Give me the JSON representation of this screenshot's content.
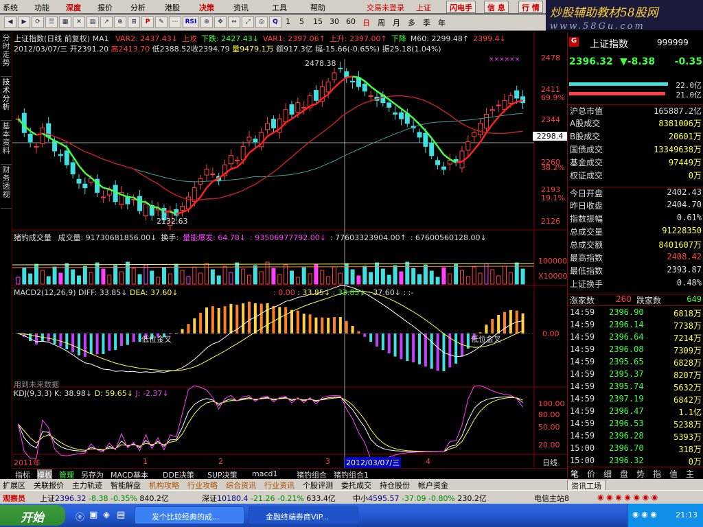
{
  "menu": {
    "items": [
      "系统",
      "功能",
      "深度",
      "报价",
      "分析",
      "港股",
      "决策",
      "资讯",
      "工具",
      "帮助"
    ],
    "login_status": "交易未登录",
    "shortcut": "上证",
    "buttons": [
      "闪电手",
      "信 息",
      "行 情"
    ]
  },
  "brand": {
    "name": "炒股辅助教材58股网",
    "url": "www.58Gu.com"
  },
  "toolbar": {
    "icons": [
      "P",
      "RSI",
      "Q"
    ],
    "periods": [
      "1",
      "5",
      "15",
      "30",
      "60",
      "日",
      "周",
      "月",
      "多",
      "季",
      "年"
    ]
  },
  "left_tabs": [
    "分时走势",
    "技术分析",
    "基本资料",
    "财务透视"
  ],
  "main": {
    "title": "上证指数(日线 前复权) MA1",
    "indicators": [
      {
        "text": "VAR2: 2437.43↓",
        "color": "#ff4040"
      },
      {
        "text": "上攻",
        "color": "#ff4040"
      },
      {
        "text": "下跌: 2427.43↓",
        "color": "#40ff40"
      },
      {
        "text": "VAR1: 2397.06↑",
        "color": "#ff4040"
      },
      {
        "text": "上升: 2397.00↑",
        "color": "#ff4040"
      },
      {
        "text": "下降",
        "color": "#40ff40"
      },
      {
        "text": "M60: 2299.48↑",
        "color": "#dddddd"
      },
      {
        "text": "2399.4↓",
        "color": "#ff4040"
      }
    ],
    "ohlc": {
      "date": "2012/03/07/三",
      "open": "开2391.20",
      "high": "高2413.70",
      "low": "低2388.52",
      "close": "收2394.79",
      "vol": "量9479.1万",
      "amount": "额917.3亿",
      "change": "幅-15.66(-0.65%)",
      "amplitude": "振25.18(1.04%)"
    },
    "price_axis": [
      "2478",
      "2411",
      "69.9%",
      "2344",
      "2298.4",
      "2260",
      "38.2%",
      "2193",
      "19.1%",
      "2126"
    ],
    "annotations": {
      "high": "2478.38",
      "low": "2132.63"
    },
    "current_price_tag": "2298.4"
  },
  "volume": {
    "title": "猪钓成交量",
    "items": [
      {
        "text": "成交量: 91730681856.00↓",
        "color": "#dddddd"
      },
      {
        "text": "换手:",
        "color": "#dddddd"
      },
      {
        "text": "量能爆发: 64.78↓",
        "color": "#ff40ff"
      },
      {
        "text": ": 93506977792.00↓",
        "color": "#ff40ff"
      },
      {
        "text": ": 77603323904.00↑",
        "color": "#dddddd"
      },
      {
        "text": ": 67600560128.00↓",
        "color": "#dddddd"
      }
    ],
    "axis": [
      "100000",
      "X10000"
    ]
  },
  "macd": {
    "title": "MACD2(12,26,9)",
    "diff": "DIFF: 33.85↓",
    "dea": "DEA: 37.60↓",
    "extra": [
      ": 0.00",
      ": 33.85↓",
      ": 33.85↓",
      ": 37.60↓",
      ": :-"
    ],
    "zero_label": "0.00",
    "golden_cross": "低位金叉",
    "footer": "用到未来数据"
  },
  "kdj": {
    "title": "KDJ(9,3,3)",
    "k": "K: 38.98↓",
    "d": "D: 59.65↓",
    "j": "J: -2.37↓",
    "axis": [
      "100.00",
      "80.00",
      "50.00",
      "20.00"
    ]
  },
  "x_axis": {
    "labels": [
      "2011年",
      "1",
      "2",
      "3",
      "4"
    ],
    "selected": "2012/03/07/三",
    "period": "日线"
  },
  "bottom_tabs": [
    "指标",
    "模板",
    "管理",
    "另存为",
    "MACD基本",
    "DDE决策",
    "SUP决策",
    "macd1",
    "猪钓组合",
    "猪钓组合1"
  ],
  "bottom_tabs2": [
    "扩展区",
    "关联报价",
    "主力轨迹",
    "智能解盘",
    "机构攻略",
    "行业攻略",
    "综合资讯",
    "行业资讯",
    "个股评测",
    "委托成交",
    "持仓股份",
    "帐户资金"
  ],
  "right_panel": {
    "header_letter": "G",
    "name": "上证指数",
    "code": "999999",
    "price": "2396.32",
    "change": "▼-8.38",
    "pct": "-0.35",
    "bar1": "22.0亿",
    "bar2": "21.0亿",
    "total_mv": {
      "label": "沪总市值",
      "value": "165887.2亿"
    },
    "turnover": [
      {
        "label": "A股成交",
        "value": "8381006万"
      },
      {
        "label": "B股成交",
        "value": "20601万"
      },
      {
        "label": "国债成交",
        "value": "13349638万"
      },
      {
        "label": "基金成交",
        "value": "97449万"
      },
      {
        "label": "权证成交",
        "value": "0万"
      }
    ],
    "stats": [
      {
        "label": "今日开盘",
        "value": "2402.43",
        "color": "#dddddd"
      },
      {
        "label": "昨日收盘",
        "value": "2404.70",
        "color": "#dddddd"
      },
      {
        "label": "指数振幅",
        "value": "0.61%",
        "color": "#dddddd"
      },
      {
        "label": "总成交量",
        "value": "91228350",
        "color": "#ffff40"
      },
      {
        "label": "总成交额",
        "value": "8401607万",
        "color": "#ffff40"
      },
      {
        "label": "最高指数",
        "value": "2408.42",
        "color": "#ff4040"
      },
      {
        "label": "最低指数",
        "value": "2393.87",
        "color": "#dddddd"
      },
      {
        "label": "上证换手",
        "value": "0.48%",
        "color": "#dddddd"
      }
    ],
    "updown": {
      "up_label": "涨家数",
      "up": "260",
      "down_label": "跌家数",
      "down": "649"
    },
    "ticks": [
      {
        "time": "14:59",
        "price": "2396.90",
        "vol": "6818万"
      },
      {
        "time": "14:59",
        "price": "2396.14",
        "vol": "7738万"
      },
      {
        "time": "14:59",
        "price": "2396.64",
        "vol": "7214万"
      },
      {
        "time": "14:59",
        "price": "2396.08",
        "vol": "7309万"
      },
      {
        "time": "14:59",
        "price": "2395.65",
        "vol": "6828万"
      },
      {
        "time": "14:59",
        "price": "2395.37",
        "vol": "8207万"
      },
      {
        "time": "14:59",
        "price": "2395.74",
        "vol": "5632万"
      },
      {
        "time": "14:59",
        "price": "2397.19",
        "vol": "6842万"
      },
      {
        "time": "14:59",
        "price": "2396.47",
        "vol": "1.1亿"
      },
      {
        "time": "14:59",
        "price": "2396.53",
        "vol": "5238万"
      },
      {
        "time": "14:59",
        "price": "2396.28",
        "vol": "5393万"
      },
      {
        "time": "15:00",
        "price": "2396.70",
        "vol": "318万"
      },
      {
        "time": "15:00",
        "price": "2396.32",
        "vol": "0万"
      }
    ],
    "tabs": [
      "笔",
      "价",
      "细",
      "盘",
      "势",
      "指",
      "值",
      "主"
    ],
    "info_button": "资讯工场"
  },
  "status_bar": {
    "label": "观察员",
    "sh": {
      "name": "上证",
      "value": "2396.32",
      "chg": "-8.38",
      "pct": "-0.35%",
      "amt": "840.2亿"
    },
    "sz": {
      "name": "深证",
      "value": "10180.4",
      "chg": "-21.26",
      "pct": "-0.21%",
      "amt": "633.4亿"
    },
    "zx": {
      "name": "中小",
      "value": "4595.57",
      "chg": "-37.09",
      "pct": "-0.80%",
      "amt": "230.2亿"
    },
    "server": "电信主站8"
  },
  "taskbar": {
    "start": "开始",
    "tasks": [
      "发个比较经典的成...",
      "金融终端券商VIP..."
    ],
    "time": "21:13"
  }
}
